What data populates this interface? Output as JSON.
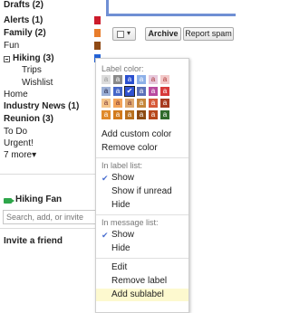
{
  "sidebar": {
    "labels": [
      {
        "name": "Drafts (2)",
        "bold": true,
        "color": null
      },
      {
        "name": "Alerts (1)",
        "bold": true,
        "color": "#cc1b2b"
      },
      {
        "name": "Family (2)",
        "bold": true,
        "color": "#e87d2c"
      },
      {
        "name": "Fun",
        "bold": false,
        "color": "#8f4a15"
      },
      {
        "name": "Hiking (3)",
        "bold": true,
        "color": "#2463d6"
      },
      {
        "name": "Trips",
        "bold": false,
        "color": null
      },
      {
        "name": "Wishlist",
        "bold": false,
        "color": null
      },
      {
        "name": "Home",
        "bold": false,
        "color": null
      },
      {
        "name": "Industry News (1)",
        "bold": true,
        "color": null
      },
      {
        "name": "Reunion (3)",
        "bold": true,
        "color": null
      },
      {
        "name": "To Do",
        "bold": false,
        "color": null
      },
      {
        "name": "Urgent!",
        "bold": false,
        "color": null
      },
      {
        "name": "7 more▾",
        "bold": false,
        "color": null
      }
    ],
    "chat_name": "Hiking Fan",
    "search_placeholder": "Search, add, or invite",
    "invite": "Invite a friend"
  },
  "toolbar": {
    "archive": "Archive",
    "report_spam": "Report spam"
  },
  "menu": {
    "label_color_header": "Label color:",
    "color_rows": [
      [
        [
          "#dcdcdc",
          "#999"
        ],
        [
          "#8a8a8a",
          "#fff"
        ],
        [
          "#2a4fcf",
          "#fff"
        ],
        [
          "#8db0e8",
          "#fff"
        ],
        [
          "#e7c9dd",
          "#a33"
        ],
        [
          "#f3c9c9",
          "#a33"
        ]
      ],
      [
        [
          "#9cb0d6",
          "#224"
        ],
        [
          "#4566c8",
          "#fff"
        ],
        [
          "#3052d1",
          "#fff"
        ],
        [
          "#5a6fb8",
          "#fff"
        ],
        [
          "#b94a9f",
          "#fff"
        ],
        [
          "#d83a3a",
          "#fff"
        ]
      ],
      [
        [
          "#f5c58a",
          "#733"
        ],
        [
          "#f3a45a",
          "#733"
        ],
        [
          "#dfa96f",
          "#733"
        ],
        [
          "#c5863b",
          "#fff"
        ],
        [
          "#d65a3a",
          "#fff"
        ],
        [
          "#a83a1f",
          "#fff"
        ]
      ],
      [
        [
          "#e08a2c",
          "#fff"
        ],
        [
          "#d27a1b",
          "#fff"
        ],
        [
          "#b9701e",
          "#fff"
        ],
        [
          "#8d4a12",
          "#fff"
        ],
        [
          "#b7471b",
          "#fff"
        ],
        [
          "#2f6b2b",
          "#fff"
        ]
      ]
    ],
    "chip_letter": "a",
    "add_custom_color": "Add custom color",
    "remove_color": "Remove color",
    "label_list_header": "In label list:",
    "label_list_options": [
      "Show",
      "Show if unread",
      "Hide"
    ],
    "message_list_header": "In message list:",
    "message_list_options": [
      "Show",
      "Hide"
    ],
    "edit": "Edit",
    "remove_label": "Remove label",
    "add_sublabel": "Add sublabel"
  },
  "colors": {
    "accent": "#4a6fd0",
    "highlight": "#fdf9cf"
  }
}
